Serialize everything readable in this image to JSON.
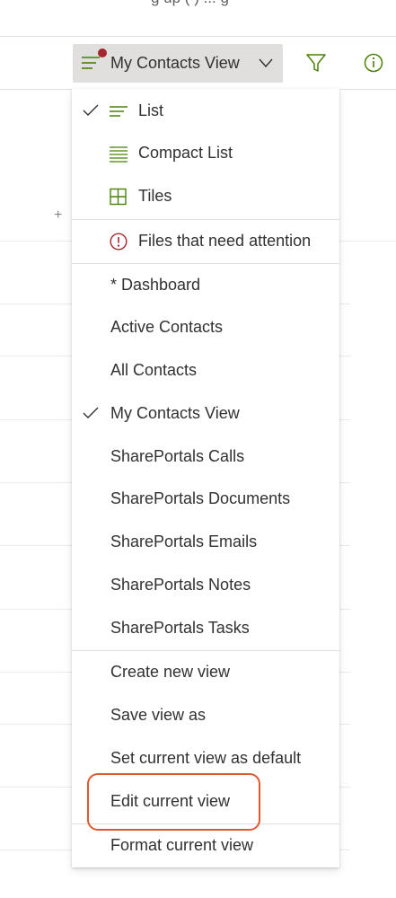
{
  "header": {
    "cut_text": "g up ( ) ... g"
  },
  "toolbar": {
    "view_label": "My Contacts View",
    "icons": {
      "view": "list-lines-icon",
      "chevron": "chevron-down-icon",
      "filter": "filter-icon",
      "info": "info-icon"
    },
    "colors": {
      "accent": "#498205",
      "badge": "#a4262c"
    }
  },
  "menu": {
    "layout": [
      {
        "label": "List",
        "icon": "list-lines-icon",
        "checked": true
      },
      {
        "label": "Compact List",
        "icon": "compact-list-icon",
        "checked": false
      },
      {
        "label": "Tiles",
        "icon": "tiles-grid-icon",
        "checked": false
      }
    ],
    "attention": {
      "label": "Files that need attention",
      "icon": "alert-circle-icon"
    },
    "views": [
      {
        "label": "* Dashboard",
        "checked": false
      },
      {
        "label": "Active Contacts",
        "checked": false
      },
      {
        "label": "All Contacts",
        "checked": false
      },
      {
        "label": "My Contacts View",
        "checked": true
      },
      {
        "label": "SharePortals Calls",
        "checked": false
      },
      {
        "label": "SharePortals Documents",
        "checked": false
      },
      {
        "label": "SharePortals Emails",
        "checked": false
      },
      {
        "label": "SharePortals Notes",
        "checked": false
      },
      {
        "label": "SharePortals Tasks",
        "checked": false
      }
    ],
    "actions": [
      {
        "label": "Create new view"
      },
      {
        "label": "Save view as"
      },
      {
        "label": "Set current view as default"
      },
      {
        "label": "Edit current view"
      },
      {
        "label": "Format current view"
      }
    ]
  },
  "background": {
    "add_column": "+"
  }
}
